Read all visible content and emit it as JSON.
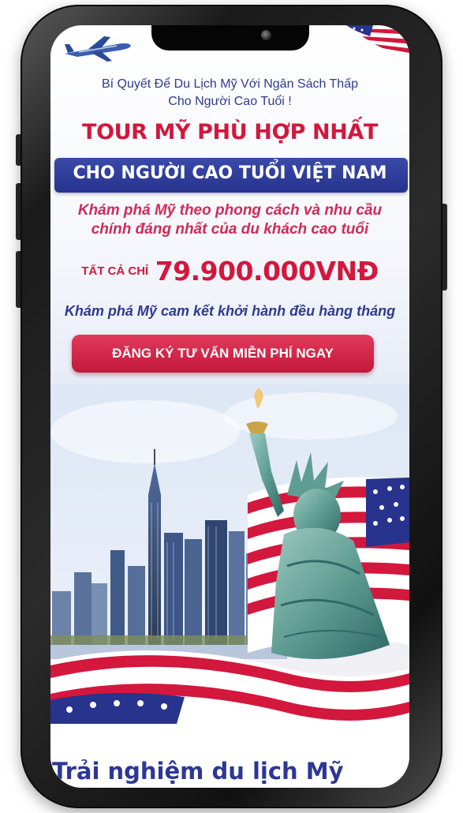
{
  "intro": {
    "line1": "Bí Quyết Để Du Lịch Mỹ Với Ngân Sách Thấp",
    "line2": "Cho Người Cao Tuổi !"
  },
  "headline": {
    "title": "TOUR MỸ PHÙ HỢP NHẤT",
    "subtitle": "CHO NGƯỜI CAO TUỔI VIỆT NAM"
  },
  "description": {
    "line1": "Khám phá Mỹ theo phong cách và nhu cầu",
    "line2": "chính đáng nhất của du khách cao tuổi"
  },
  "pricing": {
    "prefix": "TẤT CẢ CHỈ",
    "price": "79.900.000VNĐ"
  },
  "commitment": "Khám phá Mỹ cam kết khởi hành đều hàng tháng",
  "cta": {
    "label": "ĐĂNG KÝ TƯ VẤN MIỄN PHÍ NGAY"
  },
  "section": {
    "title": "Trải nghiệm du lịch Mỹ"
  },
  "colors": {
    "red": "#d3173d",
    "blue": "#2f3a8f",
    "navy": "#27338d"
  }
}
